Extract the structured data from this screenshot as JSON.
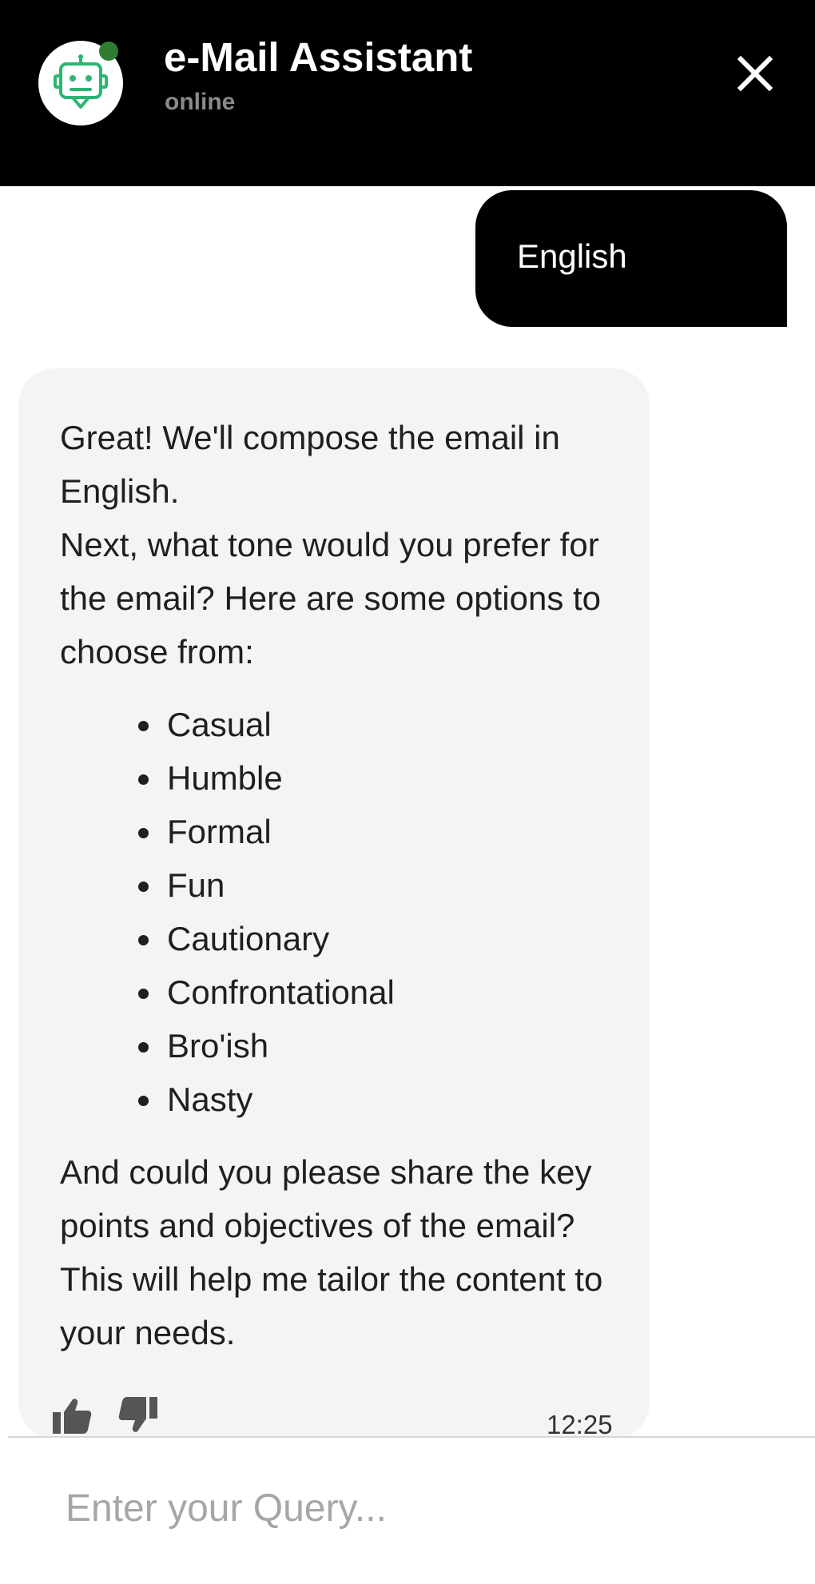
{
  "header": {
    "title": "e-Mail Assistant",
    "status": "online",
    "avatar_icon": "robot-chat-icon",
    "status_color": "#2e7d32",
    "accent_color": "#2bb673"
  },
  "messages": {
    "user": {
      "text": "English"
    },
    "bot": {
      "intro_line1": "Great! We'll compose the email in English.",
      "intro_line2": "Next, what tone would you prefer for the email? Here are some options to choose from:",
      "options": [
        "Casual",
        "Humble",
        "Formal",
        "Fun",
        "Cautionary",
        "Confrontational",
        "Bro'ish",
        "Nasty"
      ],
      "outro": "And could you please share the key points and objectives of the email? This will help me tailor the content to your needs.",
      "time": "12:25"
    }
  },
  "composer": {
    "placeholder": "Enter your Query..."
  }
}
